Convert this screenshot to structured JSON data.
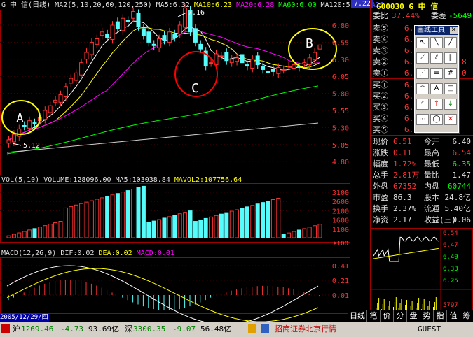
{
  "app": {
    "ma_header": {
      "name": "G 中 信(日线)",
      "ma_params": "MA2(5,10,20,60,120,250)",
      "ma5": "MA5:6.32",
      "ma10": "MA10:6.23",
      "ma20": "MA20:6.28",
      "ma60": "MA60:6.00",
      "ma120": "MA120:5.43",
      "ma250": "MA25",
      "right_val": "7.22"
    },
    "vol_header": {
      "params": "VOL(5,10)",
      "volume": "VOLUME:128096.00",
      "ma5": "MA5:103038.84",
      "mavol2": "MAVOL2:107756.64"
    },
    "macd_header": {
      "params": "MACD(12,26,9)",
      "dif": "DIF:0.02",
      "dea": "DEA:0.02",
      "macd": "MACD:0.01"
    },
    "date_label": "2005/12/29/四",
    "colors": {
      "up": "#ff3333",
      "down": "#54fcfc",
      "ma5": "#ffffff",
      "ma10": "#ffff00",
      "ma20": "#ff00ff",
      "ma60": "#00ff00",
      "ma120": "#d0d0d0",
      "annot_yellow": "#ffff00",
      "annot_red": "#ff0000"
    }
  },
  "annotations": {
    "a": "A",
    "b": "B",
    "c": "C",
    "high": "7.16",
    "low": "5.12"
  },
  "axis": {
    "price_ticks": [
      "6.80",
      "6.55",
      "6.30",
      "6.05",
      "5.80",
      "5.55",
      "5.30",
      "5.05",
      "4.80"
    ],
    "vol_ticks": [
      "3100",
      "2600",
      "2100",
      "1600",
      "1100"
    ],
    "vol_unit": "X100",
    "macd_ticks": [
      "0.41",
      "0.21",
      "0.01"
    ]
  },
  "quote": {
    "code": "600030 G 中 信",
    "webi_label": "委比",
    "webi_val": "37.44%",
    "wecha_label": "委差",
    "wecha_val": "-5649",
    "sell": [
      {
        "label": "卖⑤",
        "price": "6.",
        "vol": ""
      },
      {
        "label": "卖④",
        "price": "6.",
        "vol": ""
      },
      {
        "label": "卖③",
        "price": "6.",
        "vol": ""
      },
      {
        "label": "卖②",
        "price": "6.",
        "vol": "8"
      },
      {
        "label": "卖①",
        "price": "6.",
        "vol": "0"
      }
    ],
    "buy": [
      {
        "label": "买①",
        "price": "6."
      },
      {
        "label": "买②",
        "price": "6."
      },
      {
        "label": "买③",
        "price": "6."
      },
      {
        "label": "买④",
        "price": "6."
      },
      {
        "label": "买⑤",
        "price": "6."
      }
    ],
    "stats": [
      {
        "l1": "现价",
        "v1": "6.51",
        "l2": "今开",
        "v2": "6.40"
      },
      {
        "l1": "涨跌",
        "v1": "0.11",
        "l2": "最高",
        "v2": "6.54"
      },
      {
        "l1": "幅度",
        "v1": "1.72%",
        "l2": "最低",
        "v2": "6.35"
      },
      {
        "l1": "总手",
        "v1": "2.81万",
        "l2": "量比",
        "v2": "1.47"
      },
      {
        "l1": "外盘",
        "v1": "67352",
        "l2": "内盘",
        "v2": "60744"
      },
      {
        "l1": "市盈",
        "v1": "86.3",
        "l2": "股本",
        "v2": "24.8亿"
      },
      {
        "l1": "换手",
        "v1": "2.37%",
        "l2": "流通",
        "v2": "5.40亿"
      },
      {
        "l1": "净资",
        "v1": "2.17",
        "l2": "收益(三)",
        "v2": "0.06"
      }
    ],
    "mini_ticks": [
      "6.54",
      "6.47",
      "6.40",
      "6.33",
      "6.25"
    ],
    "mini_vol": "5797"
  },
  "toolbar": {
    "title": "画线工具",
    "close": "×"
  },
  "status": {
    "sh_label": "沪",
    "sh_val": "1269.46",
    "sh_chg": "-4.73",
    "sh_amt": "93.69亿",
    "sz_label": "深",
    "sz_val": "3300.35",
    "sz_chg": "-9.07",
    "sz_amt": "56.48亿",
    "broker": "招商证券北京行情",
    "user": "GUEST"
  },
  "tabs": [
    "日线",
    "笔",
    "价",
    "分",
    "盘",
    "势",
    "指",
    "值",
    "筹"
  ]
}
